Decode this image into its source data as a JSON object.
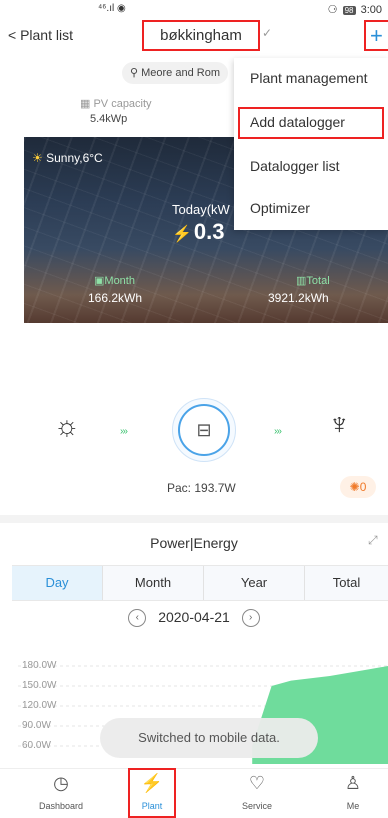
{
  "status_bar": {
    "signal": "⁴⁶.ıl ◉",
    "right_icons": "⚆",
    "battery": "98",
    "time": "3:00"
  },
  "header": {
    "back_label": "< Plant list",
    "plant_name": "bøkkingham",
    "plus_symbol": "+"
  },
  "location": {
    "text": "Meore and Rom"
  },
  "pv_capacity": {
    "label": "PV capacity",
    "value": "5.4kWp"
  },
  "hero": {
    "weather": "Sunny,6°C",
    "today_label": "Today(kW",
    "today_value": "0.3",
    "month_label": "Month",
    "month_value": "166.2kWh",
    "total_label": "Total",
    "total_value": "3921.2kWh"
  },
  "dropdown_menu": {
    "items": [
      "Plant management",
      "Add datalogger",
      "Datalogger list",
      "Optimizer"
    ],
    "highlighted_index": 1
  },
  "flow": {
    "pac_text": "Pac: 193.7W",
    "alarm_count": "0"
  },
  "power_energy": {
    "title": "Power|Energy",
    "tabs": [
      "Day",
      "Month",
      "Year",
      "Total"
    ],
    "active_tab": "Day",
    "date": "2020-04-21"
  },
  "chart_data": {
    "type": "area",
    "title": "",
    "xlabel": "",
    "ylabel": "",
    "y_ticks": [
      "180.0W",
      "150.0W",
      "120.0W",
      "90.0W",
      "60.0W"
    ],
    "ylim": [
      60,
      180
    ],
    "series": [
      {
        "values_fraction_of_width": [
          [
            0.65,
            60
          ],
          [
            0.7,
            150
          ],
          [
            0.75,
            158
          ],
          [
            0.85,
            165
          ],
          [
            0.95,
            175
          ],
          [
            1.0,
            180
          ]
        ]
      }
    ],
    "fill_color": "#6fdc9c"
  },
  "toast": {
    "text": "Switched to mobile data."
  },
  "bottom_nav": {
    "items": [
      {
        "label": "Dashboard",
        "icon": "dashboard-icon"
      },
      {
        "label": "Plant",
        "icon": "plant-icon"
      },
      {
        "label": "Service",
        "icon": "service-icon"
      },
      {
        "label": "Me",
        "icon": "me-icon"
      }
    ],
    "active": "Plant"
  },
  "colors": {
    "accent": "#2a8fd8",
    "highlight_box": "#e22222",
    "green": "#34c06a"
  }
}
